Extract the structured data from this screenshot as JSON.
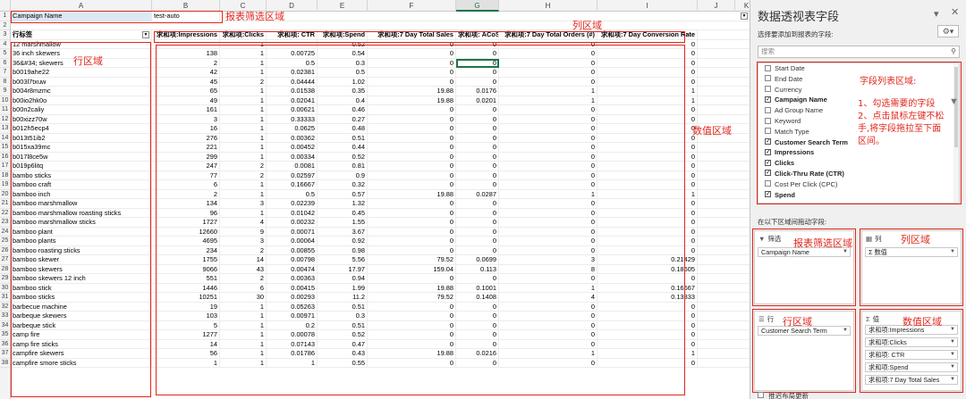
{
  "sheet": {
    "columns": [
      "A",
      "B",
      "C",
      "D",
      "E",
      "F",
      "G",
      "H",
      "I",
      "J",
      "K"
    ],
    "selected_column": "G",
    "filter": {
      "field": "Campaign Name",
      "value": "test-auto"
    },
    "headers": [
      "行标签",
      "求和项:Impressions",
      "求和项:Clicks",
      "求和项: CTR",
      "求和项:Spend",
      "求和项:7 Day Total Sales",
      "求和项: ACoS)",
      "求和项:7 Day Total Orders (#)",
      "求和项:7 Day Conversion Rate"
    ],
    "rows": [
      [
        "12 marshmallow",
        "",
        "1",
        "",
        "0.52",
        "0",
        "0",
        "0",
        "0"
      ],
      [
        "36 inch skewers",
        "138",
        "1",
        "0.00725",
        "0.54",
        "0",
        "0",
        "0",
        "0"
      ],
      [
        "36&#34; skewers",
        "2",
        "1",
        "0.5",
        "0.3",
        "0",
        "0",
        "0",
        "0"
      ],
      [
        "b0019ahe22",
        "42",
        "1",
        "0.02381",
        "0.5",
        "0",
        "0",
        "0",
        "0"
      ],
      [
        "b003l7txuw",
        "45",
        "2",
        "0.04444",
        "1.02",
        "0",
        "0",
        "0",
        "0"
      ],
      [
        "b004r8mzmc",
        "65",
        "1",
        "0.01538",
        "0.35",
        "19.88",
        "0.0176",
        "1",
        "1"
      ],
      [
        "b00io2hk0o",
        "49",
        "1",
        "0.02041",
        "0.4",
        "19.88",
        "0.0201",
        "1",
        "1"
      ],
      [
        "b00n2caliy",
        "161",
        "1",
        "0.00621",
        "0.46",
        "0",
        "0",
        "0",
        "0"
      ],
      [
        "b00xizz70w",
        "3",
        "1",
        "0.33333",
        "0.27",
        "0",
        "0",
        "0",
        "0"
      ],
      [
        "b012h5ecp4",
        "16",
        "1",
        "0.0625",
        "0.48",
        "0",
        "0",
        "0",
        "0"
      ],
      [
        "b013t51ib2",
        "276",
        "1",
        "0.00362",
        "0.51",
        "0",
        "0",
        "0",
        "0"
      ],
      [
        "b015xa39mc",
        "221",
        "1",
        "0.00452",
        "0.44",
        "0",
        "0",
        "0",
        "0"
      ],
      [
        "b017l8ce5w",
        "299",
        "1",
        "0.00334",
        "0.52",
        "0",
        "0",
        "0",
        "0"
      ],
      [
        "b019p6litq",
        "247",
        "2",
        "0.0081",
        "0.81",
        "0",
        "0",
        "0",
        "0"
      ],
      [
        "bambo sticks",
        "77",
        "2",
        "0.02597",
        "0.9",
        "0",
        "0",
        "0",
        "0"
      ],
      [
        "bamboo craft",
        "6",
        "1",
        "0.16667",
        "0.32",
        "0",
        "0",
        "0",
        "0"
      ],
      [
        "bamboo inch",
        "2",
        "1",
        "0.5",
        "0.57",
        "19.88",
        "0.0287",
        "1",
        "1"
      ],
      [
        "bamboo marshmallow",
        "134",
        "3",
        "0.02239",
        "1.32",
        "0",
        "0",
        "0",
        "0"
      ],
      [
        "bamboo marshmallow roasting sticks",
        "96",
        "1",
        "0.01042",
        "0.45",
        "0",
        "0",
        "0",
        "0"
      ],
      [
        "bamboo marshmallow sticks",
        "1727",
        "4",
        "0.00232",
        "1.55",
        "0",
        "0",
        "0",
        "0"
      ],
      [
        "bamboo plant",
        "12660",
        "9",
        "0.00071",
        "3.67",
        "0",
        "0",
        "0",
        "0"
      ],
      [
        "bamboo plants",
        "4695",
        "3",
        "0.00064",
        "0.92",
        "0",
        "0",
        "0",
        "0"
      ],
      [
        "bamboo roasting sticks",
        "234",
        "2",
        "0.00855",
        "0.98",
        "0",
        "0",
        "0",
        "0"
      ],
      [
        "bamboo skewer",
        "1755",
        "14",
        "0.00798",
        "5.56",
        "79.52",
        "0.0699",
        "3",
        "0.21429"
      ],
      [
        "bamboo skewers",
        "9066",
        "43",
        "0.00474",
        "17.97",
        "159.04",
        "0.113",
        "8",
        "0.18605"
      ],
      [
        "bamboo skewers 12 inch",
        "551",
        "2",
        "0.00363",
        "0.94",
        "0",
        "0",
        "0",
        "0"
      ],
      [
        "bamboo stick",
        "1446",
        "6",
        "0.00415",
        "1.99",
        "19.88",
        "0.1001",
        "1",
        "0.16667"
      ],
      [
        "bamboo sticks",
        "10251",
        "30",
        "0.00293",
        "11.2",
        "79.52",
        "0.1408",
        "4",
        "0.13333"
      ],
      [
        "barbecue machine",
        "19",
        "1",
        "0.05263",
        "0.51",
        "0",
        "0",
        "0",
        "0"
      ],
      [
        "barbeque skewers",
        "103",
        "1",
        "0.00971",
        "0.3",
        "0",
        "0",
        "0",
        "0"
      ],
      [
        "barbeque stick",
        "5",
        "1",
        "0.2",
        "0.51",
        "0",
        "0",
        "0",
        "0"
      ],
      [
        "camp fire",
        "1277",
        "1",
        "0.00078",
        "0.52",
        "0",
        "0",
        "0",
        "0"
      ],
      [
        "camp fire sticks",
        "14",
        "1",
        "0.07143",
        "0.47",
        "0",
        "0",
        "0",
        "0"
      ],
      [
        "campfire skewers",
        "56",
        "1",
        "0.01786",
        "0.43",
        "19.88",
        "0.0216",
        "1",
        "1"
      ],
      [
        "campfire smore sticks",
        "1",
        "1",
        "1",
        "0.55",
        "0",
        "0",
        "0",
        "0"
      ]
    ],
    "annotations": {
      "filter": "报表筛选区域",
      "columns": "列区域",
      "rows": "行区域",
      "values": "数值区域"
    }
  },
  "panel": {
    "title": "数据透视表字段",
    "choose_label": "选择要添加到报表的字段:",
    "search_placeholder": "搜索",
    "fields": [
      {
        "label": "Start Date",
        "checked": false
      },
      {
        "label": "End Date",
        "checked": false
      },
      {
        "label": "Currency",
        "checked": false
      },
      {
        "label": "Campaign Name",
        "checked": true
      },
      {
        "label": "Ad Group Name",
        "checked": false
      },
      {
        "label": "Keyword",
        "checked": false
      },
      {
        "label": "Match Type",
        "checked": false
      },
      {
        "label": "Customer Search Term",
        "checked": true
      },
      {
        "label": "Impressions",
        "checked": true
      },
      {
        "label": "Clicks",
        "checked": true
      },
      {
        "label": "Click-Thru Rate (CTR)",
        "checked": true
      },
      {
        "label": "Cost Per Click (CPC)",
        "checked": false
      },
      {
        "label": "Spend",
        "checked": true
      }
    ],
    "field_note": {
      "title": "字段列表区域:",
      "line1": "1、勾选需要的字段",
      "line2": "2、点击鼠标左键不松",
      "line3": "手,将字段拖拉至下面",
      "line4": "区间。"
    },
    "drag_label": "在以下区域间拖动字段:",
    "filter_area": {
      "head": "筛选",
      "items": [
        "Campaign Name"
      ],
      "note": "报表筛选区域"
    },
    "column_area": {
      "head": "列",
      "items": [
        "Σ 数值"
      ],
      "note": "列区域"
    },
    "row_area": {
      "head": "行",
      "items": [
        "Customer Search Term"
      ],
      "note": "行区域"
    },
    "value_area": {
      "head": "值",
      "items": [
        "求和项:Impressions",
        "求和项:Clicks",
        "求和项: CTR",
        "求和项:Spend",
        "求和项:7 Day Total Sales"
      ],
      "note": "数值区域"
    },
    "defer_label": "推迟布局更新"
  }
}
